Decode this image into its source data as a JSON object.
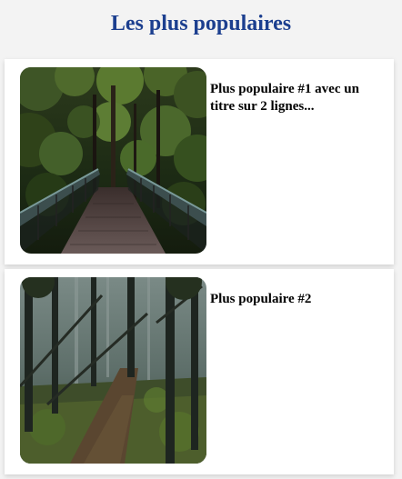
{
  "section": {
    "title": "Les plus populaires"
  },
  "items": [
    {
      "title": "Plus populaire #1 avec un titre sur 2 lignes...",
      "image": "forest-bridge"
    },
    {
      "title": "Plus populaire #2",
      "image": "forest-path"
    }
  ]
}
